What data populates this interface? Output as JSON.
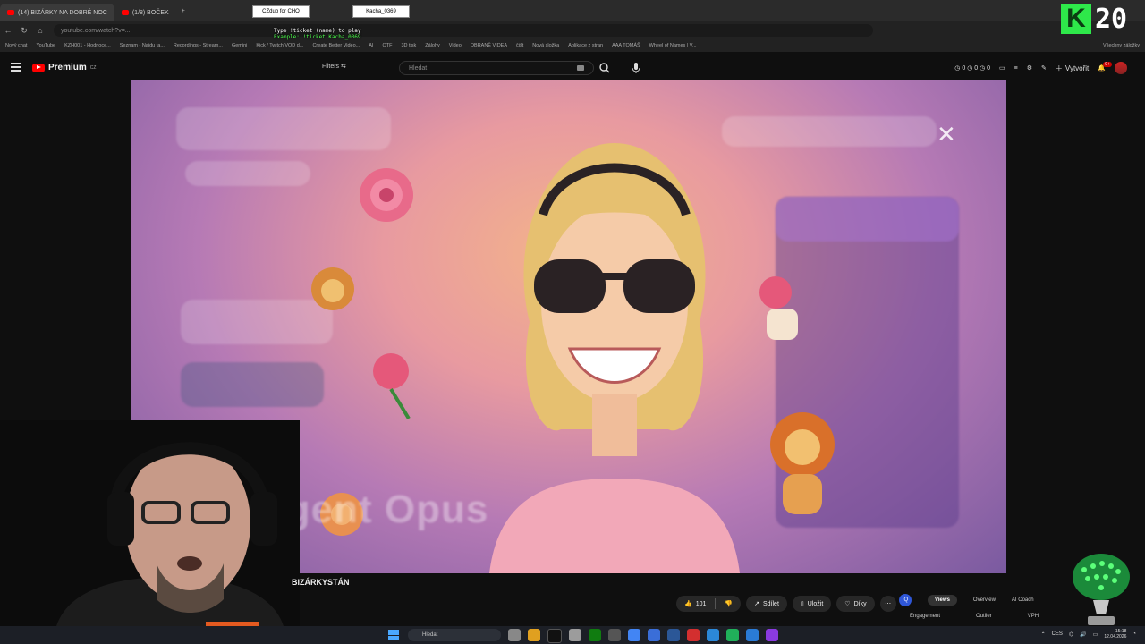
{
  "browser": {
    "tabs": [
      {
        "label": "(14) BIZÁRKY NA DOBRÉ NOC",
        "active": true
      },
      {
        "label": "(1/8) BOČEK",
        "active": false
      }
    ],
    "new_tab": "+",
    "url": "youtube.com/watch?v=...",
    "bookmarks": [
      "Nový chat",
      "YouTube",
      "KZH001 - Hodnoce...",
      "Seznam - Najdu ta...",
      "Recordings - Stream...",
      "Gemini",
      "Kick / Twitch VOD d...",
      "Create Better Video...",
      "AI",
      "OTF",
      "3D tisk",
      "Zálohy",
      "Video",
      "OBRANĚ VIDEA",
      "čišt",
      "Nová složka",
      "Aplikace z stran",
      "AAA TOMÁŠ",
      "Wheel of Names | V...",
      "Všechny záložky"
    ],
    "overlay_boxes": [
      "CZdub for CHO",
      "Kacha_0369"
    ]
  },
  "ticker": {
    "line1": "Type !ticket (name) to play",
    "line2": "Example: !ticket Kacha_0369"
  },
  "badge": {
    "letter": "K",
    "number": "20"
  },
  "youtube": {
    "logo": "Premium",
    "logo_sup": "CZ",
    "filters": "Filters",
    "search_placeholder": "Hledat",
    "create": "Vytvořit",
    "notifications": "9+"
  },
  "video": {
    "watermark": "Agent Opus",
    "title": "BIZÁRKYSTÁN"
  },
  "actions": {
    "likes": "101",
    "share": "Sdílet",
    "save": "Uložit",
    "thanks": "Díky"
  },
  "extension": {
    "logo": "IQ",
    "tabs": [
      "Views",
      "Overview",
      "AI Coach"
    ],
    "sub": [
      "Engagement",
      "Outlier",
      "VPH"
    ]
  },
  "taskbar": {
    "search": "Hledat",
    "lang": "CES",
    "time": "15:18",
    "date": "12.04.2026"
  },
  "colors": {
    "accent": "#ff0000",
    "badge_green": "#2ee84a"
  }
}
